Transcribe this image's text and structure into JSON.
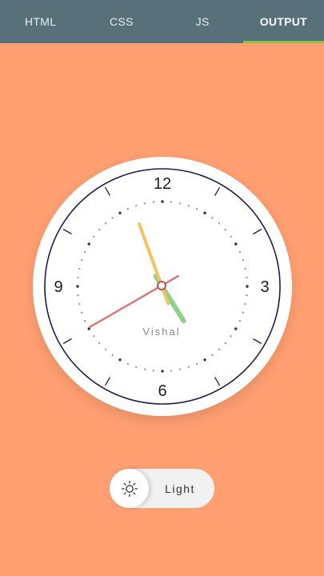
{
  "tabs": [
    {
      "label": "HTML",
      "active": false
    },
    {
      "label": "CSS",
      "active": false
    },
    {
      "label": "JS",
      "active": false
    },
    {
      "label": "OUTPUT",
      "active": true
    }
  ],
  "clock": {
    "numerals": {
      "twelve": "12",
      "three": "3",
      "six": "6",
      "nine": "9"
    },
    "brand": "Vishal",
    "time": {
      "hours": 10,
      "minutes": 56,
      "seconds": 40
    },
    "colors": {
      "hour_hand": "#8FD18A",
      "minute_hand": "#F2C264",
      "second_hand": "#D67A7A",
      "ring": "#1C1C4C"
    }
  },
  "theme_toggle": {
    "label": "Light",
    "icon": "sun-icon"
  },
  "colors": {
    "background": "#FF9F72",
    "tabbar": "#57707A",
    "active_tab_indicator": "#8BC34A"
  }
}
